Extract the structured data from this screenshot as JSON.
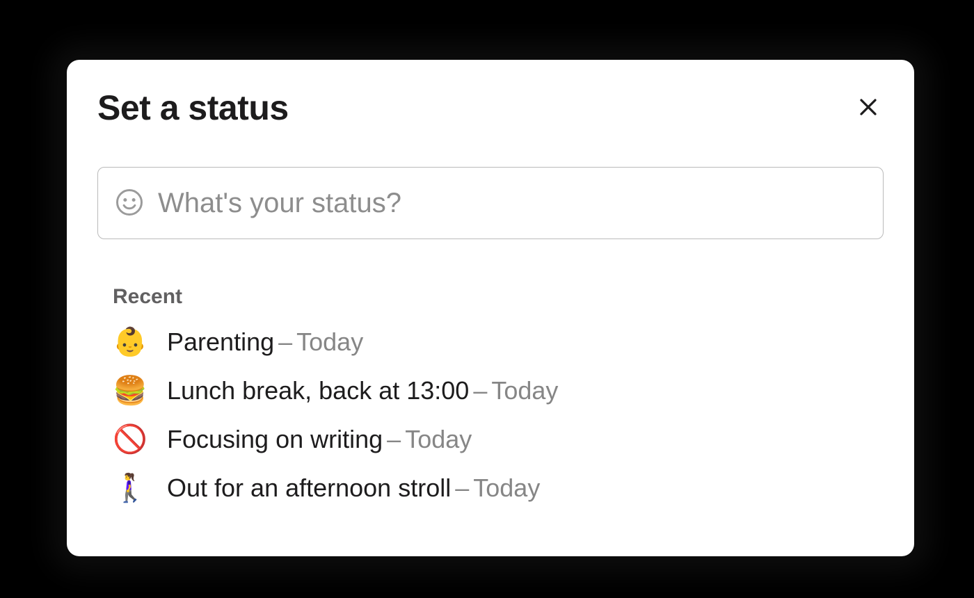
{
  "modal": {
    "title": "Set a status",
    "input_placeholder": "What's your status?"
  },
  "recent": {
    "heading": "Recent",
    "items": [
      {
        "emoji": "👶",
        "emoji_name": "baby",
        "label": "Parenting",
        "sep": "–",
        "duration": "Today"
      },
      {
        "emoji": "🍔",
        "emoji_name": "hamburger",
        "label": "Lunch break, back at 13:00",
        "sep": "–",
        "duration": "Today"
      },
      {
        "emoji": "🚫",
        "emoji_name": "no-entry",
        "label": "Focusing on writing",
        "sep": "–",
        "duration": "Today"
      },
      {
        "emoji": "🚶‍♀️",
        "emoji_name": "woman-walking",
        "label": "Out for an afternoon stroll",
        "sep": "–",
        "duration": "Today"
      }
    ]
  }
}
